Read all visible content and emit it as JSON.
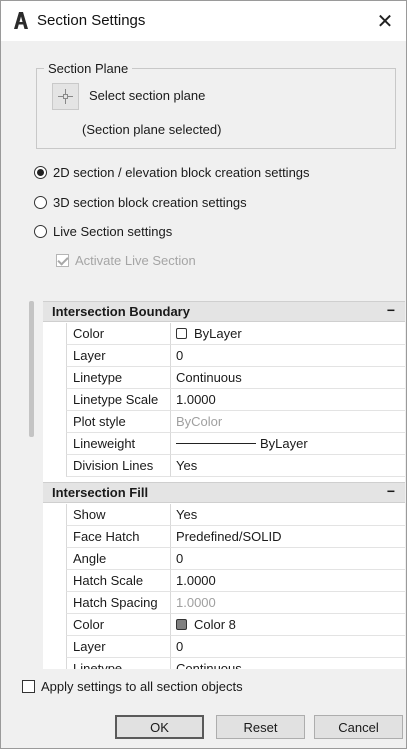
{
  "window": {
    "title": "Section Settings",
    "close_glyph": "✕"
  },
  "section_plane": {
    "legend": "Section Plane",
    "select_label": "Select section plane",
    "status": "(Section plane selected)"
  },
  "options": {
    "radio_2d": "2D section / elevation block creation settings",
    "radio_3d": "3D section block creation settings",
    "radio_live": "Live Section settings",
    "selected": "2D section / elevation block creation settings",
    "activate_live": "Activate Live Section"
  },
  "intersection_boundary": {
    "title": "Intersection Boundary",
    "collapse": "−",
    "rows": [
      {
        "name": "Color",
        "value": "ByLayer"
      },
      {
        "name": "Layer",
        "value": "0"
      },
      {
        "name": "Linetype",
        "value": "Continuous"
      },
      {
        "name": "Linetype Scale",
        "value": "1.0000"
      },
      {
        "name": "Plot style",
        "value": "ByColor"
      },
      {
        "name": "Lineweight",
        "value": "ByLayer"
      },
      {
        "name": "Division Lines",
        "value": "Yes"
      }
    ]
  },
  "intersection_fill": {
    "title": "Intersection Fill",
    "collapse": "−",
    "rows": [
      {
        "name": "Show",
        "value": "Yes"
      },
      {
        "name": "Face Hatch",
        "value": "Predefined/SOLID"
      },
      {
        "name": "Angle",
        "value": "0"
      },
      {
        "name": "Hatch Scale",
        "value": "1.0000"
      },
      {
        "name": "Hatch Spacing",
        "value": "1.0000"
      },
      {
        "name": "Color",
        "value": "Color 8"
      },
      {
        "name": "Layer",
        "value": "0"
      },
      {
        "name": "Linetype",
        "value": "Continuous"
      }
    ]
  },
  "footer": {
    "apply_all": "Apply settings to all section objects",
    "ok": "OK",
    "reset": "Reset",
    "cancel": "Cancel"
  },
  "colors": {
    "swatch_bylayer": "#ffffff",
    "swatch_color8": "#808080",
    "accent_app_icon": "#2b2b2b"
  },
  "icons": {
    "app": "autocad-a-icon",
    "pick": "crosshair-pick-icon",
    "close": "close-icon"
  }
}
